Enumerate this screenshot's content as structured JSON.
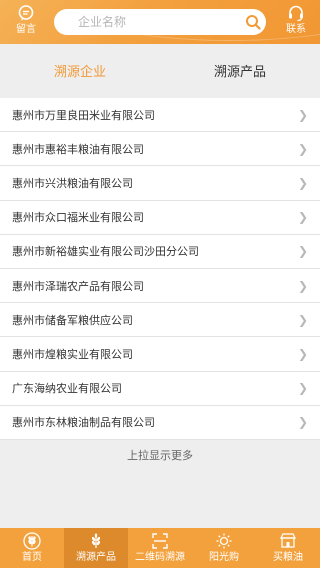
{
  "header": {
    "message_label": "留言",
    "contact_label": "联系",
    "search_placeholder": "企业名称"
  },
  "tabs": [
    {
      "label": "溯源企业",
      "active": true
    },
    {
      "label": "溯源产品",
      "active": false
    }
  ],
  "companies": [
    "惠州市万里良田米业有限公司",
    "惠州市惠裕丰粮油有限公司",
    "惠州市兴洪粮油有限公司",
    "惠州市众口福米业有限公司",
    "惠州市新裕雄实业有限公司沙田分公司",
    "惠州市泽瑞农产品有限公司",
    "惠州市储备军粮供应公司",
    "惠州市煌粮实业有限公司",
    "广东海纳农业有限公司",
    "惠州市东林粮油制品有限公司"
  ],
  "load_more": "上拉显示更多",
  "tabbar": [
    {
      "label": "首页",
      "icon": "wheat-icon",
      "active": false
    },
    {
      "label": "溯源产品",
      "icon": "sprout-icon",
      "active": true
    },
    {
      "label": "二维码溯源",
      "icon": "qr-scan-icon",
      "active": false
    },
    {
      "label": "阳光购",
      "icon": "sun-icon",
      "active": false
    },
    {
      "label": "买粮油",
      "icon": "shop-icon",
      "active": false
    }
  ],
  "colors": {
    "accent": "#f19a36",
    "bar": "#f3a13c",
    "bar_active": "#dc8a2b"
  }
}
